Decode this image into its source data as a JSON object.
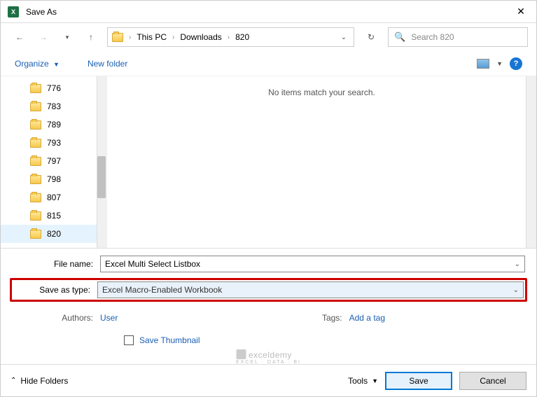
{
  "titlebar": {
    "title": "Save As"
  },
  "breadcrumb": {
    "root": "This PC",
    "mid": "Downloads",
    "leaf": "820"
  },
  "search": {
    "placeholder": "Search 820"
  },
  "toolbar": {
    "organize": "Organize",
    "newfolder": "New folder"
  },
  "tree": {
    "items": [
      {
        "name": "776"
      },
      {
        "name": "783"
      },
      {
        "name": "789"
      },
      {
        "name": "793"
      },
      {
        "name": "797"
      },
      {
        "name": "798"
      },
      {
        "name": "807"
      },
      {
        "name": "815"
      },
      {
        "name": "820"
      }
    ]
  },
  "content": {
    "empty_message": "No items match your search."
  },
  "form": {
    "filename_label": "File name:",
    "filename_value": "Excel Multi Select Listbox",
    "type_label": "Save as type:",
    "type_value": "Excel Macro-Enabled Workbook",
    "authors_label": "Authors:",
    "authors_value": "User",
    "tags_label": "Tags:",
    "tags_value": "Add a tag",
    "thumbnail_label": "Save Thumbnail"
  },
  "watermark": {
    "brand": "exceldemy",
    "sub": "EXCEL · DATA · BI"
  },
  "footer": {
    "hide_folders": "Hide Folders",
    "tools": "Tools",
    "save": "Save",
    "cancel": "Cancel"
  }
}
